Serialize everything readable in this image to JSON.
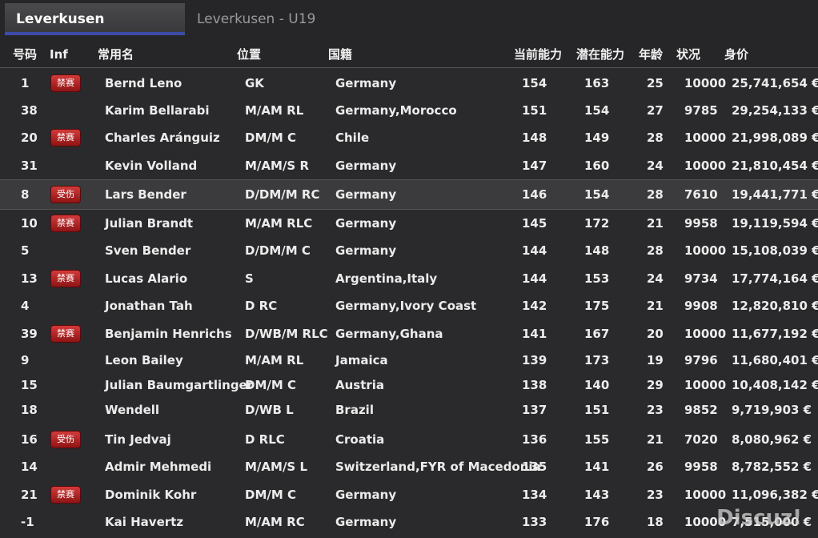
{
  "tabs": [
    {
      "label": "Leverkusen",
      "active": true
    },
    {
      "label": "Leverkusen - U19",
      "active": false
    }
  ],
  "columns": {
    "number": "号码",
    "inf": "Inf",
    "name": "常用名",
    "position": "位置",
    "nationality": "国籍",
    "ca": "当前能力",
    "pa": "潜在能力",
    "age": "年龄",
    "condition": "状况",
    "value": "身价"
  },
  "players": [
    {
      "number": "1",
      "inf": "禁赛",
      "name": "Bernd Leno",
      "position": "GK",
      "nationality": "Germany",
      "ca": "154",
      "pa": "163",
      "age": "25",
      "condition": "10000",
      "value": "25,741,654 €"
    },
    {
      "number": "38",
      "inf": "",
      "name": "Karim Bellarabi",
      "position": "M/AM RL",
      "nationality": "Germany,Morocco",
      "ca": "151",
      "pa": "154",
      "age": "27",
      "condition": "9785",
      "value": "29,254,133 €"
    },
    {
      "number": "20",
      "inf": "禁赛",
      "name": "Charles Aránguiz",
      "position": "DM/M C",
      "nationality": "Chile",
      "ca": "148",
      "pa": "149",
      "age": "28",
      "condition": "10000",
      "value": "21,998,089 €"
    },
    {
      "number": "31",
      "inf": "",
      "name": "Kevin Volland",
      "position": "M/AM/S R",
      "nationality": "Germany",
      "ca": "147",
      "pa": "160",
      "age": "24",
      "condition": "10000",
      "value": "21,810,454 €"
    },
    {
      "number": "8",
      "inf": "受伤",
      "name": "Lars Bender",
      "position": "D/DM/M RC",
      "nationality": "Germany",
      "ca": "146",
      "pa": "154",
      "age": "28",
      "condition": "7610",
      "value": "19,441,771 €"
    },
    {
      "number": "10",
      "inf": "禁赛",
      "name": "Julian Brandt",
      "position": "M/AM RLC",
      "nationality": "Germany",
      "ca": "145",
      "pa": "172",
      "age": "21",
      "condition": "9958",
      "value": "19,119,594 €"
    },
    {
      "number": "5",
      "inf": "",
      "name": "Sven Bender",
      "position": "D/DM/M C",
      "nationality": "Germany",
      "ca": "144",
      "pa": "148",
      "age": "28",
      "condition": "10000",
      "value": "15,108,039 €"
    },
    {
      "number": "13",
      "inf": "禁赛",
      "name": "Lucas Alario",
      "position": "S",
      "nationality": "Argentina,Italy",
      "ca": "144",
      "pa": "153",
      "age": "24",
      "condition": "9734",
      "value": "17,774,164 €"
    },
    {
      "number": "4",
      "inf": "",
      "name": "Jonathan Tah",
      "position": "D RC",
      "nationality": "Germany,Ivory Coast",
      "ca": "142",
      "pa": "175",
      "age": "21",
      "condition": "9908",
      "value": "12,820,810 €"
    },
    {
      "number": "39",
      "inf": "禁赛",
      "name": "Benjamin Henrichs",
      "position": "D/WB/M RLC",
      "nationality": "Germany,Ghana",
      "ca": "141",
      "pa": "167",
      "age": "20",
      "condition": "10000",
      "value": "11,677,192 €"
    },
    {
      "number": "9",
      "inf": "",
      "name": "Leon Bailey",
      "position": "M/AM RL",
      "nationality": "Jamaica",
      "ca": "139",
      "pa": "173",
      "age": "19",
      "condition": "9796",
      "value": "11,680,401 €"
    },
    {
      "number": "15",
      "inf": "",
      "name": "Julian Baumgartlinger",
      "position": "DM/M C",
      "nationality": "Austria",
      "ca": "138",
      "pa": "140",
      "age": "29",
      "condition": "10000",
      "value": "10,408,142 €"
    },
    {
      "number": "18",
      "inf": "",
      "name": "Wendell",
      "position": "D/WB L",
      "nationality": "Brazil",
      "ca": "137",
      "pa": "151",
      "age": "23",
      "condition": "9852",
      "value": "9,719,903 €"
    },
    {
      "number": "16",
      "inf": "受伤",
      "name": "Tin Jedvaj",
      "position": "D RLC",
      "nationality": "Croatia",
      "ca": "136",
      "pa": "155",
      "age": "21",
      "condition": "7020",
      "value": "8,080,962 €"
    },
    {
      "number": "14",
      "inf": "",
      "name": "Admir Mehmedi",
      "position": "M/AM/S L",
      "nationality": "Switzerland,FYR of Macedonia",
      "ca": "135",
      "pa": "141",
      "age": "26",
      "condition": "9958",
      "value": "8,782,552 €"
    },
    {
      "number": "21",
      "inf": "禁赛",
      "name": "Dominik Kohr",
      "position": "DM/M C",
      "nationality": "Germany",
      "ca": "134",
      "pa": "143",
      "age": "23",
      "condition": "10000",
      "value": "11,096,382 €"
    },
    {
      "number": "-1",
      "inf": "",
      "name": "Kai Havertz",
      "position": "M/AM RC",
      "nationality": "Germany",
      "ca": "133",
      "pa": "176",
      "age": "18",
      "condition": "10000",
      "value": "7,515,000 €"
    }
  ],
  "selected_player": "Lars Bender",
  "watermark": "Discuz!",
  "colors": {
    "background": "#2a2a2c",
    "tab_underline": "#3d4aa8",
    "badge": "#b82222"
  }
}
